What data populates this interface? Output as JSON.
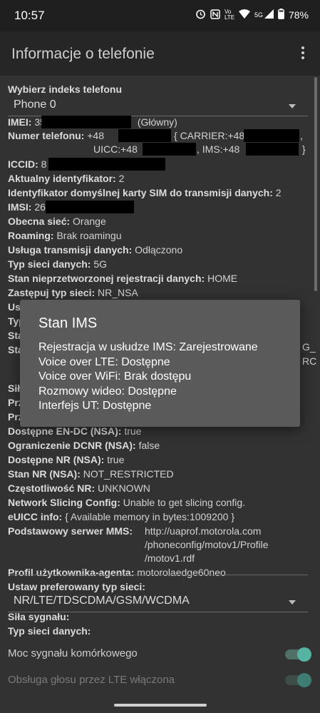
{
  "status_bar": {
    "time": "10:57",
    "icons": [
      "alarm-icon",
      "nfc-icon",
      "volte-icon",
      "wifi-icon",
      "signal-5g-icon",
      "battery-icon"
    ],
    "volte_label": "Vo LTE",
    "network_label": "5G",
    "battery": "78%"
  },
  "app_bar": {
    "title": "Informacje o telefonie"
  },
  "phone_index": {
    "label": "Wybierz indeks telefonu",
    "selected": "Phone 0"
  },
  "info": {
    "imei": {
      "label": "IMEI:",
      "prefix": "35",
      "suffix": "(Główny)"
    },
    "phone_number": {
      "label": "Numer telefonu:",
      "value_prefix": "+48",
      "carrier": "{ CARRIER:+48",
      "carrier_end": ",",
      "uicc": "UICC:+48",
      "ims": ", IMS:+48",
      "end": "}"
    },
    "iccid": {
      "label": "ICCID:",
      "prefix": "8"
    },
    "active_id": {
      "label": "Aktualny identyfikator:",
      "value": "2"
    },
    "default_data_sim": {
      "label": "Identyfikator domyślnej karty SIM do transmisji danych:",
      "value": "2"
    },
    "imsi": {
      "label": "IMSI:",
      "prefix": "26"
    },
    "current_network": {
      "label": "Obecna sieć:",
      "value": "Orange"
    },
    "roaming": {
      "label": "Roaming:",
      "value": "Brak roamingu"
    },
    "data_service": {
      "label": "Usługa transmisji danych:",
      "value": "Odłączono"
    },
    "data_network_type": {
      "label": "Typ sieci danych:",
      "value": "5G"
    },
    "raw_data_reg": {
      "label": "Stan nieprzetworzonej rejestracji danych:",
      "value": "HOME"
    },
    "override_network": {
      "label": "Zastępuj typ sieci:",
      "value": "NR_NSA"
    },
    "partial_rows": [
      "Us",
      "Typ",
      "Sta",
      "Sta",
      "Sił",
      "Prz",
      "Prz"
    ],
    "partial_right": [
      "G_",
      "RC"
    ],
    "endc": {
      "label": "Dostępne EN-DC (NSA):",
      "value": "true"
    },
    "dcnr": {
      "label": "Ograniczenie DCNR (NSA):",
      "value": "false"
    },
    "nr_available": {
      "label": "Dostępne NR (NSA):",
      "value": "true"
    },
    "nr_state": {
      "label": "Stan NR (NSA):",
      "value": "NOT_RESTRICTED"
    },
    "nr_freq": {
      "label": "Częstotliwość NR:",
      "value": "UNKNOWN"
    },
    "network_slicing": {
      "label": "Network Slicing Config:",
      "value": "Unable to get slicing config."
    },
    "euicc": {
      "label": "eUICC info:",
      "value": "{ Available memory in bytes:1009200 }"
    },
    "mms_server": {
      "label": "Podstawowy serwer MMS:",
      "lines": [
        "http://uaprof.motorola.com",
        "/phoneconfig/motov1/Profile",
        "/motov1.rdf"
      ]
    },
    "user_agent": {
      "label": "Profil użytkownika-agenta:",
      "value": "motorolaedge60neo"
    }
  },
  "preferred_network": {
    "label": "Ustaw preferowany typ sieci:",
    "selected": "NR/LTE/TDSCDMA/GSM/WCDMA"
  },
  "signal_strength": {
    "label": "Siła sygnału:"
  },
  "data_type": {
    "label": "Typ sieci danych:"
  },
  "toggles": [
    {
      "label": "Moc sygnału komórkowego",
      "on": true,
      "enabled": true
    },
    {
      "label": "Obsługa głosu przez LTE włączona",
      "on": true,
      "enabled": false
    }
  ],
  "dialog": {
    "title": "Stan IMS",
    "lines": [
      "Rejestracja w usłudze IMS: Zarejestrowane",
      "Voice over LTE: Dostępne",
      "Voice over WiFi: Brak dostępu",
      "Rozmowy wideo: Dostępne",
      "Interfejs UT: Dostępne"
    ]
  }
}
